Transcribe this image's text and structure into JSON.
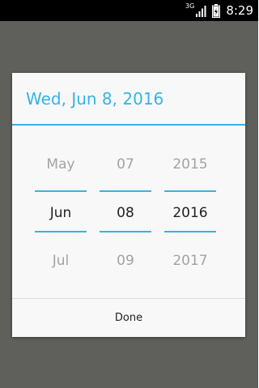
{
  "status_bar": {
    "network_type": "3G",
    "time": "8:29",
    "icons": [
      "signal-icon",
      "battery-icon"
    ]
  },
  "dialog": {
    "title": "Wed, Jun 8, 2016",
    "accent_color": "#33b5e5",
    "month_picker": {
      "previous": "May",
      "selected": "Jun",
      "next": "Jul"
    },
    "day_picker": {
      "previous": "07",
      "selected": "08",
      "next": "09"
    },
    "year_picker": {
      "previous": "2015",
      "selected": "2016",
      "next": "2017"
    },
    "done_label": "Done"
  }
}
